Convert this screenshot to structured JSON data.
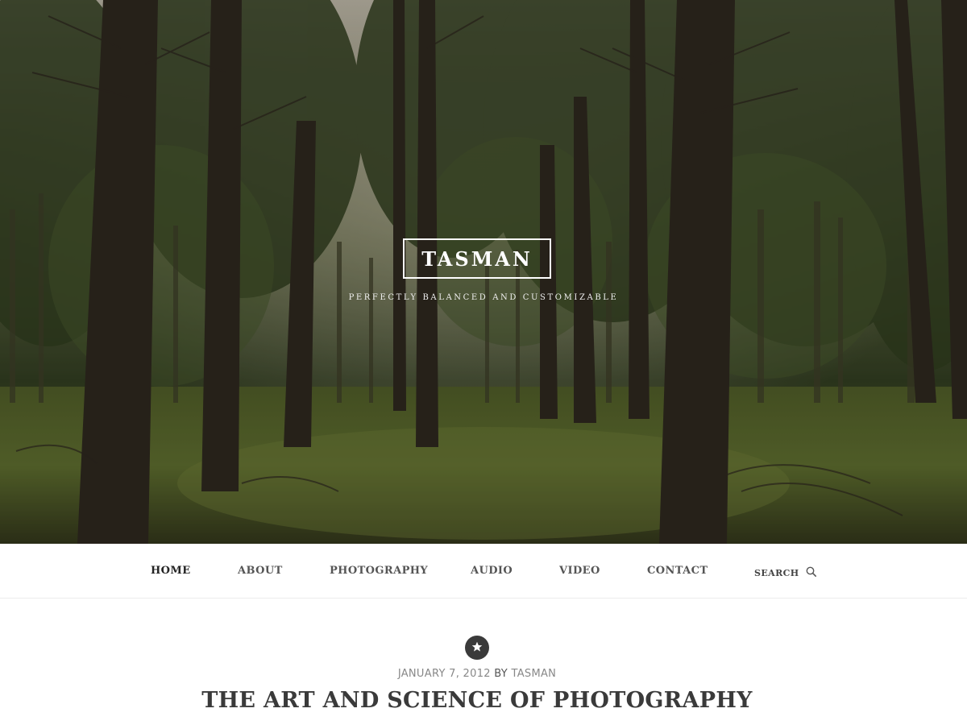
{
  "site": {
    "title": "TASMAN",
    "tagline": "PERFECTLY BALANCED AND CUSTOMIZABLE"
  },
  "nav": {
    "items": [
      {
        "label": "HOME",
        "active": true
      },
      {
        "label": "ABOUT",
        "active": false
      },
      {
        "label": "PHOTOGRAPHY",
        "active": false
      },
      {
        "label": "AUDIO",
        "active": false
      },
      {
        "label": "VIDEO",
        "active": false
      },
      {
        "label": "CONTACT",
        "active": false
      }
    ],
    "search_label": "SEARCH",
    "search_icon": "magnifier-icon"
  },
  "post": {
    "format_icon": "star-icon",
    "date": "JANUARY 7, 2012",
    "by": "BY",
    "author": "TASMAN",
    "title": "THE ART AND SCIENCE OF PHOTOGRAPHY"
  },
  "colors": {
    "text_dark": "#3a3a3a",
    "nav_text": "#555555",
    "meta_text": "#888888",
    "hero_overlay": "#14160e"
  }
}
